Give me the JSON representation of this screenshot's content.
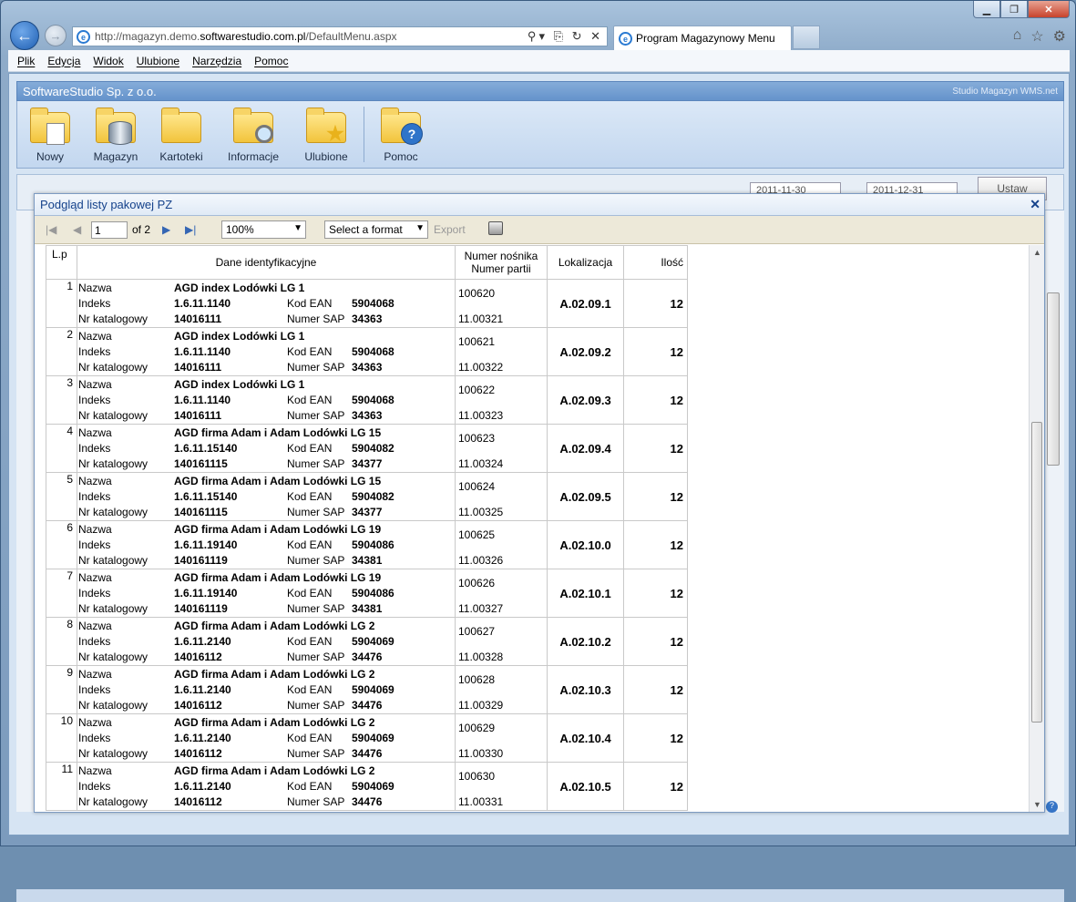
{
  "browser": {
    "address": "http://magazyn.demo.softwarestudio.com.pl/DefaultMenu.aspx",
    "address_prefix": "http://magazyn.demo.",
    "address_domain": "softwarestudio.com.pl",
    "address_path": "/DefaultMenu.aspx",
    "tab_title": "Program Magazynowy Menu"
  },
  "menubar": [
    "Plik",
    "Edycja",
    "Widok",
    "Ulubione",
    "Narzędzia",
    "Pomoc"
  ],
  "app": {
    "company": "SoftwareStudio Sp. z o.o.",
    "product": "Studio Magazyn WMS.net"
  },
  "ribbon": [
    {
      "label": "Nowy",
      "icon": "new-document-folder-icon"
    },
    {
      "label": "Magazyn",
      "icon": "database-folder-icon"
    },
    {
      "label": "Kartoteki",
      "icon": "folder-icon"
    },
    {
      "label": "Informacje",
      "icon": "search-folder-icon"
    },
    {
      "label": "Ulubione",
      "icon": "star-folder-icon"
    },
    {
      "label": "Pomoc",
      "icon": "help-folder-icon"
    }
  ],
  "background": {
    "date_from": "2011-11-30",
    "date_to": "2011-12-31",
    "apply_label": "Ustaw"
  },
  "dialog": {
    "title": "Podgląd listy pakowej PZ"
  },
  "report_toolbar": {
    "page": "1",
    "of_pages": "of 2",
    "zoom": "100%",
    "format": "Select a format",
    "export": "Export"
  },
  "table": {
    "headers": {
      "lp": "L.p",
      "ident": "Dane identyfikacyjne",
      "carrier1": "Numer nośnika",
      "carrier2": "Numer partii",
      "loc": "Lokalizacja",
      "qty": "Ilość"
    },
    "labels": {
      "name": "Nazwa",
      "index": "Indeks",
      "catalog": "Nr katalogowy",
      "ean": "Kod EAN",
      "sap": "Numer SAP"
    },
    "rows": [
      {
        "lp": "1",
        "name": "AGD index Lodówki LG 1",
        "index": "1.6.11.1140",
        "ean": "5904068",
        "catalog": "14016111",
        "sap": "34363",
        "carrier": "100620",
        "batch": "11.00321",
        "loc": "A.02.09.1",
        "qty": "12"
      },
      {
        "lp": "2",
        "name": "AGD index Lodówki LG 1",
        "index": "1.6.11.1140",
        "ean": "5904068",
        "catalog": "14016111",
        "sap": "34363",
        "carrier": "100621",
        "batch": "11.00322",
        "loc": "A.02.09.2",
        "qty": "12"
      },
      {
        "lp": "3",
        "name": "AGD index Lodówki LG 1",
        "index": "1.6.11.1140",
        "ean": "5904068",
        "catalog": "14016111",
        "sap": "34363",
        "carrier": "100622",
        "batch": "11.00323",
        "loc": "A.02.09.3",
        "qty": "12"
      },
      {
        "lp": "4",
        "name": "AGD firma Adam i Adam Lodówki LG 15",
        "index": "1.6.11.15140",
        "ean": "5904082",
        "catalog": "140161115",
        "sap": "34377",
        "carrier": "100623",
        "batch": "11.00324",
        "loc": "A.02.09.4",
        "qty": "12"
      },
      {
        "lp": "5",
        "name": "AGD firma Adam i Adam Lodówki LG 15",
        "index": "1.6.11.15140",
        "ean": "5904082",
        "catalog": "140161115",
        "sap": "34377",
        "carrier": "100624",
        "batch": "11.00325",
        "loc": "A.02.09.5",
        "qty": "12"
      },
      {
        "lp": "6",
        "name": "AGD firma Adam i Adam Lodówki LG 19",
        "index": "1.6.11.19140",
        "ean": "5904086",
        "catalog": "140161119",
        "sap": "34381",
        "carrier": "100625",
        "batch": "11.00326",
        "loc": "A.02.10.0",
        "qty": "12"
      },
      {
        "lp": "7",
        "name": "AGD firma Adam i Adam Lodówki LG 19",
        "index": "1.6.11.19140",
        "ean": "5904086",
        "catalog": "140161119",
        "sap": "34381",
        "carrier": "100626",
        "batch": "11.00327",
        "loc": "A.02.10.1",
        "qty": "12"
      },
      {
        "lp": "8",
        "name": "AGD firma Adam i Adam Lodówki LG 2",
        "index": "1.6.11.2140",
        "ean": "5904069",
        "catalog": "14016112",
        "sap": "34476",
        "carrier": "100627",
        "batch": "11.00328",
        "loc": "A.02.10.2",
        "qty": "12"
      },
      {
        "lp": "9",
        "name": "AGD firma Adam i Adam Lodówki LG 2",
        "index": "1.6.11.2140",
        "ean": "5904069",
        "catalog": "14016112",
        "sap": "34476",
        "carrier": "100628",
        "batch": "11.00329",
        "loc": "A.02.10.3",
        "qty": "12"
      },
      {
        "lp": "10",
        "name": "AGD firma Adam i Adam Lodówki LG 2",
        "index": "1.6.11.2140",
        "ean": "5904069",
        "catalog": "14016112",
        "sap": "34476",
        "carrier": "100629",
        "batch": "11.00330",
        "loc": "A.02.10.4",
        "qty": "12"
      },
      {
        "lp": "11",
        "name": "AGD firma Adam i Adam Lodówki LG 2",
        "index": "1.6.11.2140",
        "ean": "5904069",
        "catalog": "14016112",
        "sap": "34476",
        "carrier": "100630",
        "batch": "11.00331",
        "loc": "A.02.10.5",
        "qty": "12"
      }
    ]
  }
}
